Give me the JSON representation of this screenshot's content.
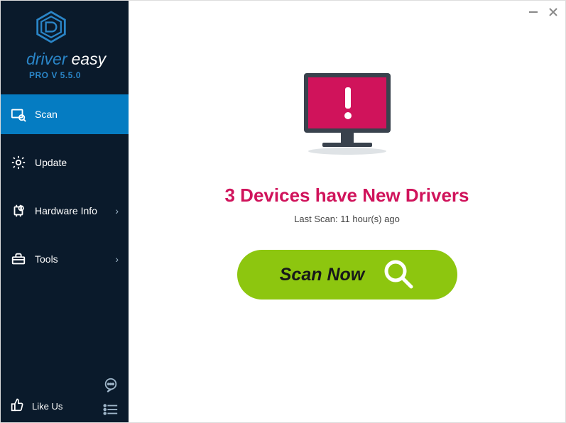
{
  "brand": {
    "title_part1": "driver",
    "title_part2": "easy",
    "version": "PRO V 5.5.0"
  },
  "nav": {
    "scan": "Scan",
    "update": "Update",
    "hardware": "Hardware Info",
    "tools": "Tools"
  },
  "sidebar_bottom": {
    "like_us": "Like Us"
  },
  "main": {
    "headline": "3 Devices have New Drivers",
    "subline": "Last Scan: 11 hour(s) ago",
    "scan_button": "Scan Now"
  },
  "colors": {
    "sidebar_bg": "#0a1a2b",
    "active": "#057cc2",
    "accent_pink": "#d0135b",
    "scan_green": "#8dc60f"
  },
  "icons": {
    "scan": "scan-icon",
    "update": "gear-icon",
    "hardware": "chip-icon",
    "tools": "toolbox-icon",
    "like": "thumbs-up-icon",
    "chat": "chat-icon",
    "menu": "menu-lines-icon",
    "minimize": "minimize-icon",
    "close": "close-icon",
    "chevron": "chevron-right-icon",
    "magnify": "magnify-icon",
    "monitor_alert": "monitor-alert-icon"
  }
}
